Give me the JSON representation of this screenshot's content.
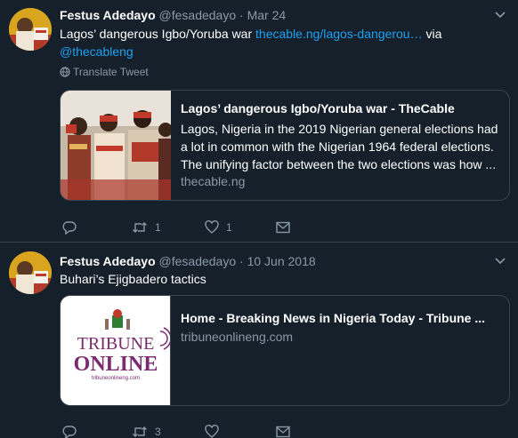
{
  "tweets": [
    {
      "name": "Festus Adedayo",
      "handle": "@fesadedayo",
      "separator": "·",
      "date": "Mar 24",
      "text_prefix": "Lagos’ dangerous Igbo/Yoruba war ",
      "link_text": "thecable.ng/lagos-dangerou…",
      "text_middle": " via",
      "mention": "@thecableng",
      "translate_label": "Translate Tweet",
      "card": {
        "title": "Lagos’ dangerous Igbo/Yoruba war - TheCable",
        "description": "Lagos, Nigeria in the 2019 Nigerian general elections had a lot in common with the Nigerian 1964 federal elections. The unifying factor between the two elections was how ...",
        "domain": "thecable.ng"
      },
      "actions": {
        "reply_count": "",
        "retweet_count": "1",
        "like_count": "1"
      }
    },
    {
      "name": "Festus Adedayo",
      "handle": "@fesadedayo",
      "separator": "·",
      "date": "10 Jun 2018",
      "text": "Buhari’s Ejigbadero tactics",
      "card": {
        "title": "Home - Breaking News in Nigeria Today - Tribune ...",
        "domain": "tribuneonlineng.com",
        "logo_line1": "TRIBUNE",
        "logo_line2": "ONLINE",
        "logo_url": "tribuneonlineng.com"
      },
      "actions": {
        "reply_count": "",
        "retweet_count": "3",
        "like_count": ""
      }
    }
  ],
  "colors": {
    "background": "#15202b",
    "border": "#38444d",
    "muted": "#8899a6",
    "link": "#1da1f2",
    "tribune_purple": "#7a2b6e"
  }
}
